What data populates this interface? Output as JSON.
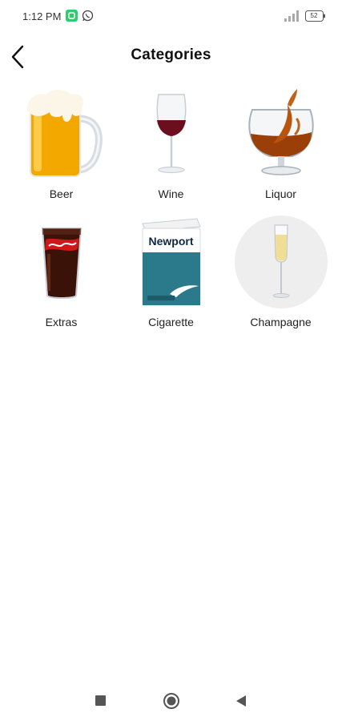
{
  "status_bar": {
    "time": "1:12 PM",
    "battery_level": "52",
    "icons": [
      "app-notification-icon",
      "whatsapp-icon",
      "signal-icon",
      "battery-icon"
    ]
  },
  "header": {
    "title": "Categories",
    "back_icon": "chevron-left-icon"
  },
  "categories": [
    {
      "label": "Beer",
      "icon": "beer-mug-image"
    },
    {
      "label": "Wine",
      "icon": "wine-glass-image"
    },
    {
      "label": "Liquor",
      "icon": "liquor-glass-image"
    },
    {
      "label": "Extras",
      "icon": "soda-glass-image"
    },
    {
      "label": "Cigarette",
      "icon": "cigarette-pack-image",
      "brand_text": "Newport"
    },
    {
      "label": "Champagne",
      "icon": "champagne-flute-image"
    }
  ],
  "nav_bar": {
    "icons": [
      "recents-icon",
      "home-icon",
      "back-icon"
    ]
  },
  "colors": {
    "background": "#ffffff",
    "text": "#111111",
    "accent_green": "#2ecc71",
    "champagne_circle": "#eeeeee"
  }
}
